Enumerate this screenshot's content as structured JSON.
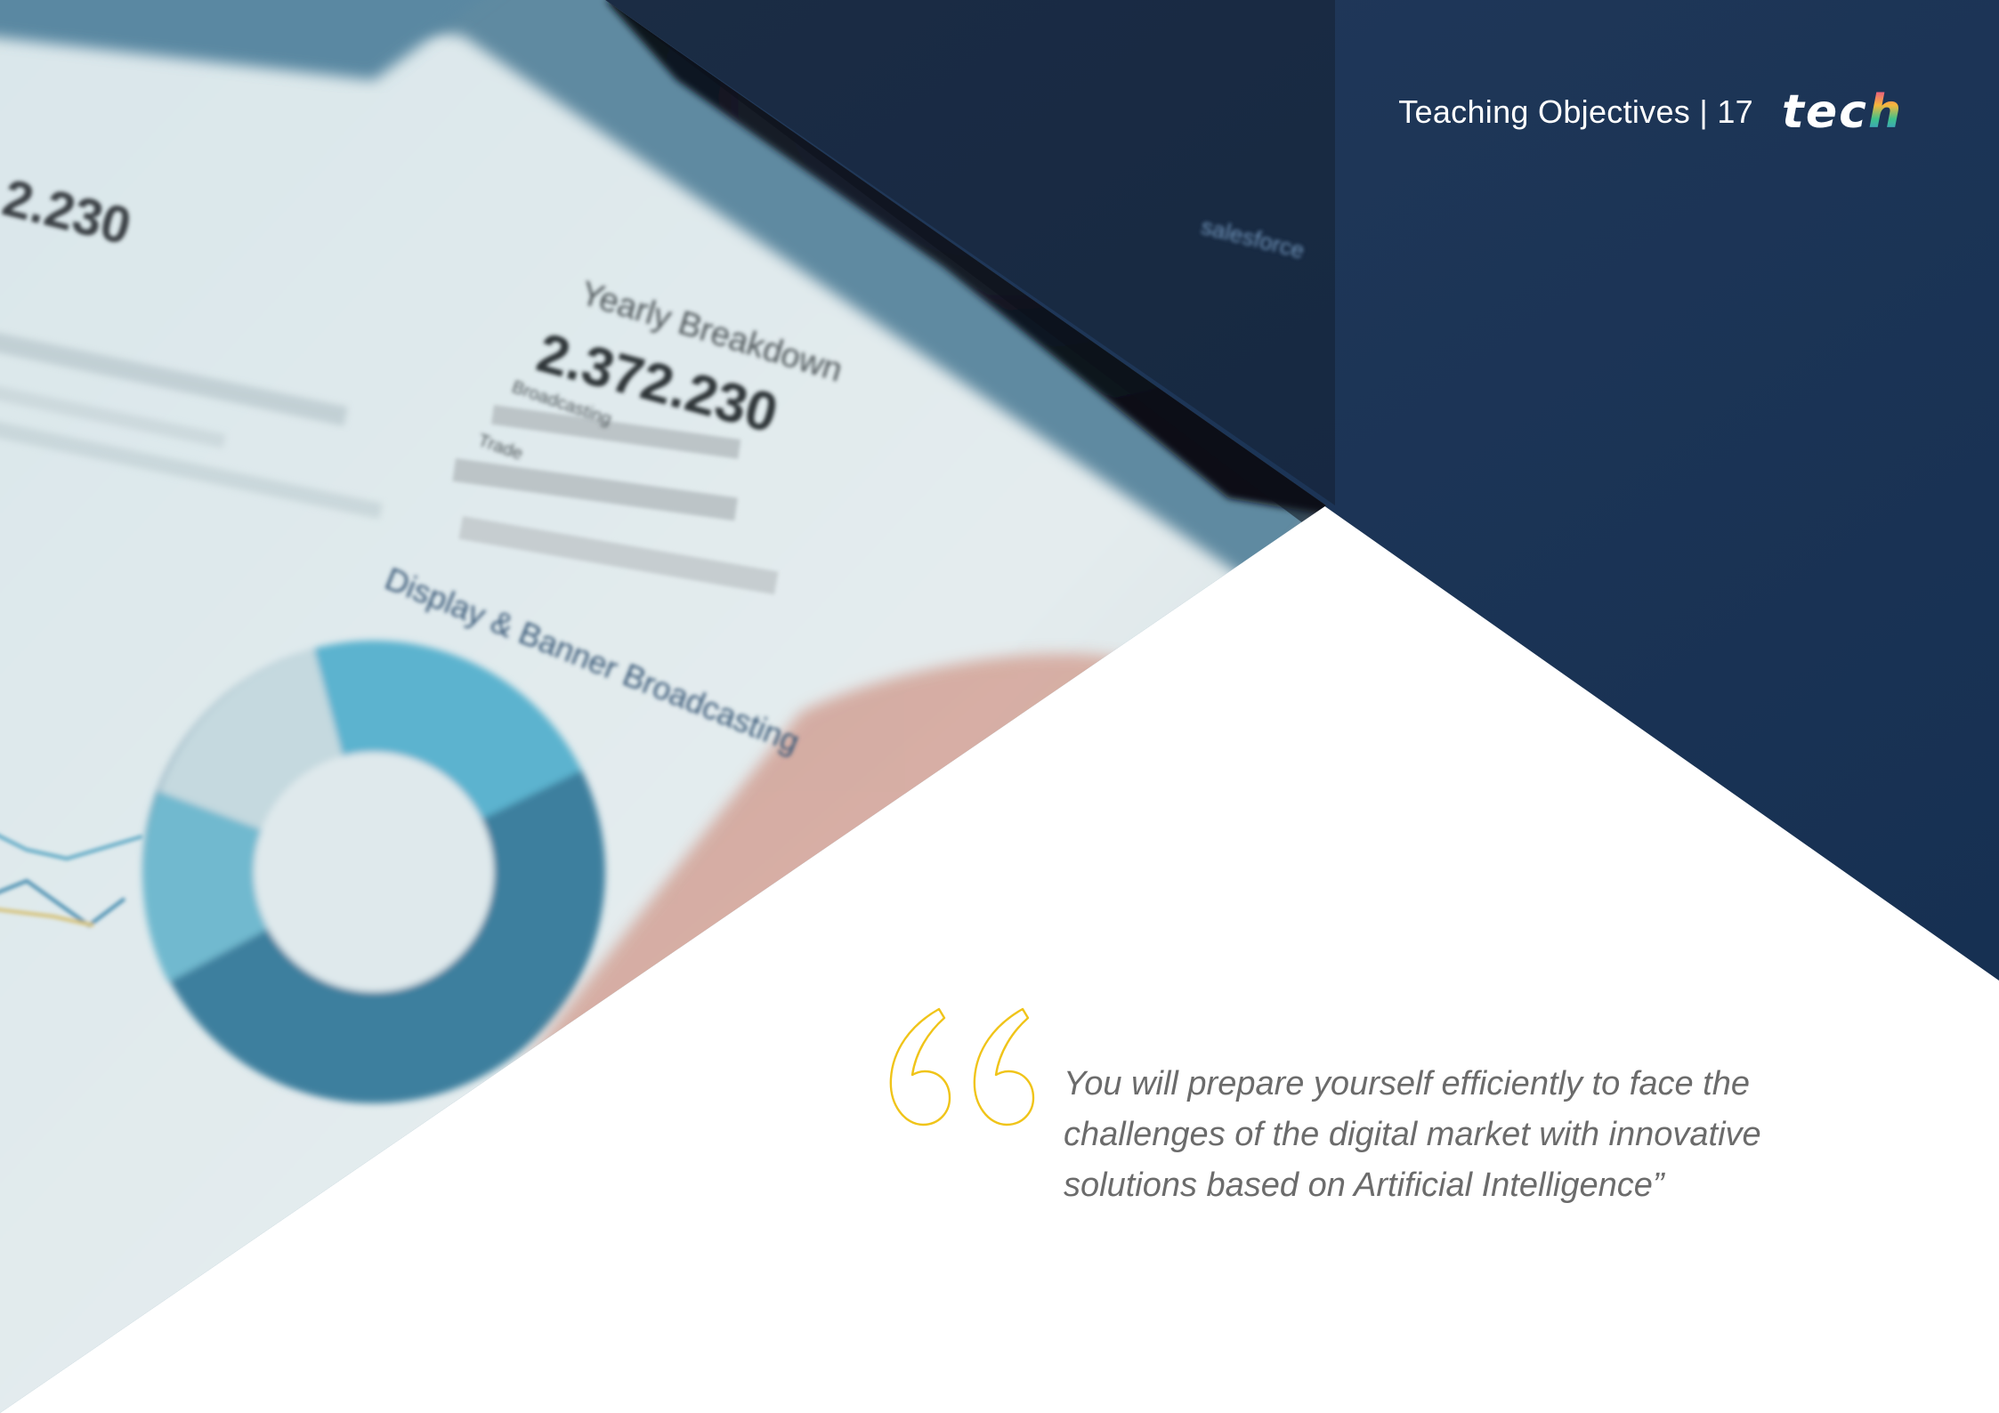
{
  "header": {
    "section_title": "Teaching Objectives | 17",
    "logo_text": "tec",
    "logo_accent_letter": "h"
  },
  "quote": {
    "icon": "open-quote-icon",
    "text": "You will prepare yourself efficiently to face the challenges of the digital market with innovative solutions based on Artificial Intelligence”"
  },
  "photo": {
    "heading_1": "Yearly Breakdown",
    "value_1": "2.372.230",
    "label_broadcasting": "Broadcasting",
    "label_trade": "Trade",
    "heading_2": "Display & Banner Broadcasting",
    "brand_badge": "salesforce",
    "corner_value": "2.230"
  },
  "colors": {
    "navy": "#1a3150",
    "dark_navy": "#0e1522",
    "quote_accent": "#f0c419",
    "quote_text": "#6b6b6b"
  }
}
